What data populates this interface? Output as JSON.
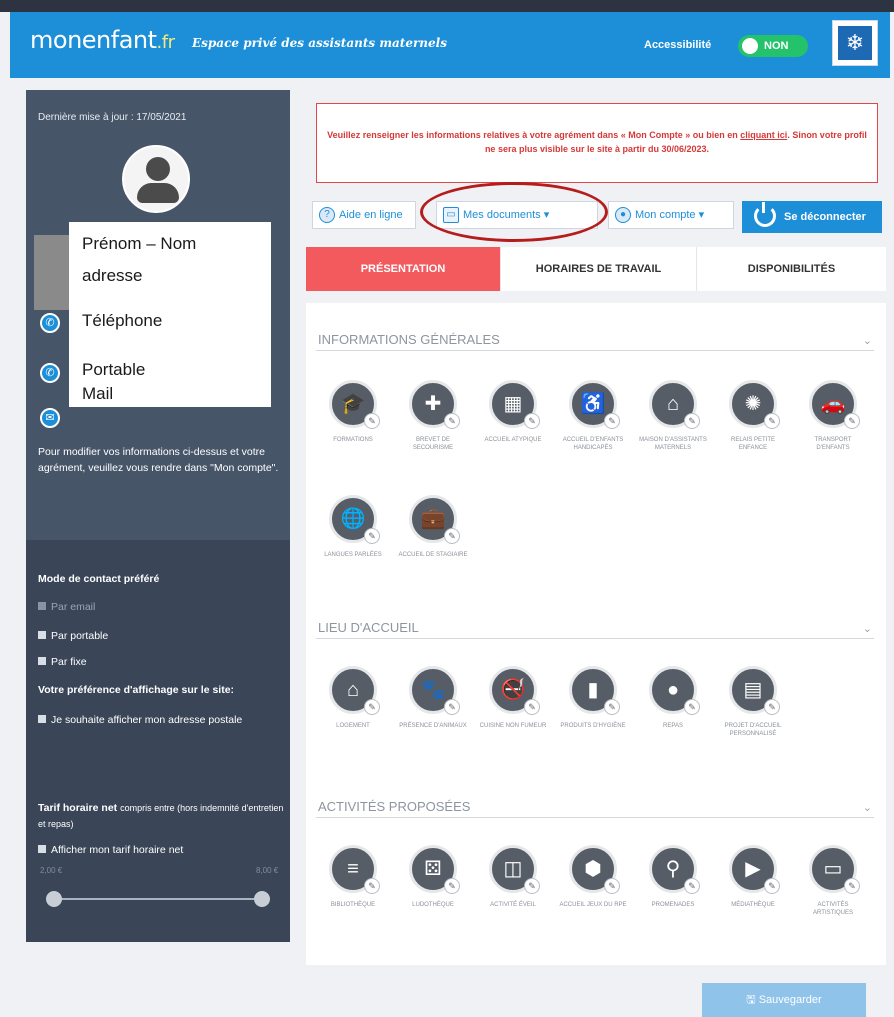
{
  "header": {
    "logo_main": "monenfant",
    "logo_suffix": ".fr",
    "tagline": "Espace privé des assistants maternels",
    "accessibility_label": "Accessibilité",
    "accessibility_toggle": "NON"
  },
  "sidebar": {
    "last_update": "Dernière mise à jour : 17/05/2021",
    "note": "Pour modifier vos informations ci-dessus et votre agrément, veuillez vous rendre dans \"Mon compte\".",
    "contact_mode_title": "Mode de contact préféré",
    "contact_options": [
      "Par email",
      "Par portable",
      "Par fixe"
    ],
    "display_pref_title": "Votre préférence d'affichage sur le site:",
    "display_pref_option": "Je souhaite afficher mon adresse postale",
    "tarif_title": "Tarif horaire net",
    "tarif_subtitle": "compris entre (hors indemnité d'entretien et repas)",
    "tarif_option": "Afficher mon tarif horaire net",
    "slider_min": "2,00 €",
    "slider_max": "8,00 €"
  },
  "overlay": {
    "line1": "Prénom – Nom",
    "line2": "adresse",
    "line3": "Téléphone",
    "line4": "Portable",
    "line5": "Mail"
  },
  "alert": {
    "text_before": "Veuillez renseigner les informations relatives à votre agrément dans « Mon Compte » ou bien en ",
    "link": "cliquant ici",
    "text_after": ". Sinon votre profil ne sera plus visible sur le site à partir du 30/06/2023."
  },
  "nav": {
    "help": "Aide en ligne",
    "documents": "Mes documents",
    "account": "Mon compte",
    "logout": "Se déconnecter"
  },
  "tabs": [
    "PRÉSENTATION",
    "HORAIRES DE TRAVAIL",
    "DISPONIBILITÉS"
  ],
  "sections": {
    "general": {
      "title": "INFORMATIONS GÉNÉRALES",
      "items": [
        {
          "label": "FORMATIONS",
          "icon": "graduation-cap-icon"
        },
        {
          "label": "BREVET DE SECOURISME",
          "icon": "first-aid-icon"
        },
        {
          "label": "ACCUEIL ATYPIQUE",
          "icon": "calendar-icon"
        },
        {
          "label": "ACCUEIL D'ENFANTS HANDICAPÉS",
          "icon": "wheelchair-icon"
        },
        {
          "label": "MAISON D'ASSISTANTS MATERNELS",
          "icon": "house-icon"
        },
        {
          "label": "RELAIS PETITE ENFANCE",
          "icon": "relay-icon"
        },
        {
          "label": "TRANSPORT D'ENFANTS",
          "icon": "car-icon"
        },
        {
          "label": "LANGUES PARLÉES",
          "icon": "globe-icon"
        },
        {
          "label": "ACCUEIL DE STAGIAIRE",
          "icon": "briefcase-icon"
        }
      ]
    },
    "lieu": {
      "title": "LIEU D'ACCUEIL",
      "items": [
        {
          "label": "LOGEMENT",
          "icon": "home-icon"
        },
        {
          "label": "PRÉSENCE D'ANIMAUX",
          "icon": "pet-icon"
        },
        {
          "label": "CUISINE NON FUMEUR",
          "icon": "no-smoking-icon"
        },
        {
          "label": "PRODUITS D'HYGIÈNE",
          "icon": "bottle-icon"
        },
        {
          "label": "REPAS",
          "icon": "apple-icon"
        },
        {
          "label": "PROJET D'ACCUEIL PERSONNALISÉ",
          "icon": "document-icon"
        }
      ]
    },
    "activites": {
      "title": "ACTIVITÉS PROPOSÉES",
      "items": [
        {
          "label": "BIBLIOTHÈQUE",
          "icon": "books-icon"
        },
        {
          "label": "LUDOTHÈQUE",
          "icon": "dice-icon"
        },
        {
          "label": "ACTIVITÉ ÉVEIL",
          "icon": "blocks-icon"
        },
        {
          "label": "ACCUEIL JEUX DU RPE",
          "icon": "box-icon"
        },
        {
          "label": "PROMENADES",
          "icon": "walk-icon"
        },
        {
          "label": "MÉDIATHÈQUE",
          "icon": "media-icon"
        },
        {
          "label": "ACTIVITÉS ARTISTIQUES",
          "icon": "easel-icon"
        }
      ]
    }
  },
  "footer": {
    "save": "Sauvegarder"
  },
  "colors": {
    "brand_blue": "#1d8fd8",
    "tab_active": "#f25a5e",
    "alert_red": "#d63838",
    "sidebar": "#475569",
    "annotation_ring": "#b51d1d"
  }
}
